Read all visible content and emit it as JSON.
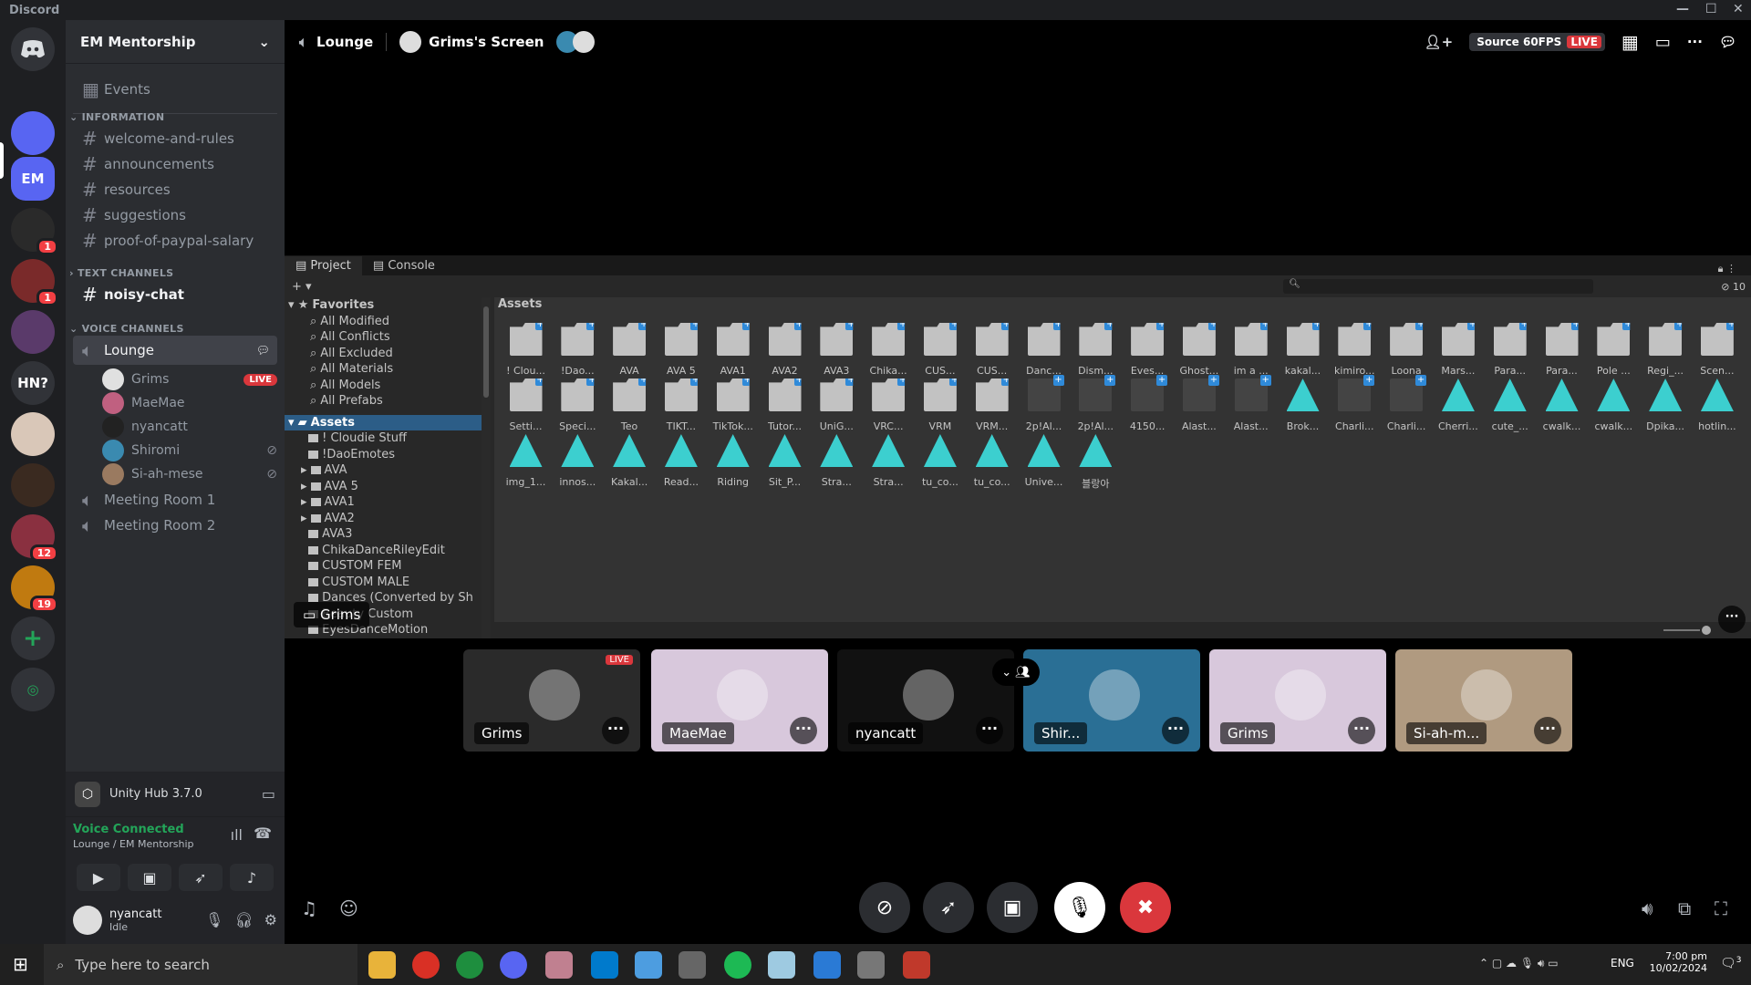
{
  "window": {
    "title": "Discord",
    "controls": [
      "—",
      "☐",
      "✕"
    ]
  },
  "guilds": [
    {
      "label": "",
      "color": "#5865f2",
      "badge": ""
    },
    {
      "label": "EM",
      "color": "#5865f2",
      "badge": ""
    },
    {
      "label": "",
      "color": "#2a2a2a",
      "badge": "1"
    },
    {
      "label": "",
      "color": "#7a2a2a",
      "badge": "1"
    },
    {
      "label": "",
      "color": "#5a3a6a",
      "badge": ""
    },
    {
      "label": "HN?",
      "color": "#313338",
      "badge": ""
    },
    {
      "label": "",
      "color": "#d9c7b8",
      "badge": ""
    },
    {
      "label": "",
      "color": "#3a2a20",
      "badge": ""
    },
    {
      "label": "",
      "color": "#8a3040",
      "badge": "12"
    },
    {
      "label": "",
      "color": "#c07a10",
      "badge": "19"
    }
  ],
  "server": {
    "name": "EM Mentorship"
  },
  "events_label": "Events",
  "categories": {
    "information": "INFORMATION",
    "text": "TEXT CHANNELS",
    "voice": "VOICE CHANNELS"
  },
  "info_channels": [
    "welcome-and-rules",
    "announcements",
    "resources",
    "suggestions",
    "proof-of-paypal-salary"
  ],
  "text_channels": [
    "noisy-chat"
  ],
  "voice_channels": {
    "lounge": "Lounge",
    "room1": "Meeting Room 1",
    "room2": "Meeting Room 2"
  },
  "voice_users": [
    {
      "name": "Grims",
      "live": "LIVE",
      "muted": false,
      "color": "#e0e0e0"
    },
    {
      "name": "MaeMae",
      "live": "",
      "muted": false,
      "color": "#c06080"
    },
    {
      "name": "nyancatt",
      "live": "",
      "muted": false,
      "color": "#222"
    },
    {
      "name": "Shiromi",
      "live": "",
      "muted": true,
      "color": "#3a8ab0"
    },
    {
      "name": "Si-ah-mese",
      "live": "",
      "muted": true,
      "color": "#9a7a60"
    }
  ],
  "activity": {
    "name": "Unity Hub 3.7.0"
  },
  "voice_status": {
    "label": "Voice Connected",
    "location": "Lounge / EM Mentorship"
  },
  "user": {
    "name": "nyancatt",
    "status": "Idle"
  },
  "topbar": {
    "channel": "Lounge",
    "screen": "Grims's Screen",
    "quality": "Source 60FPS",
    "live": "LIVE"
  },
  "unity": {
    "tabs": [
      "Project",
      "Console"
    ],
    "favorites_label": "Favorites",
    "favorites": [
      "All Modified",
      "All Conflicts",
      "All Excluded",
      "All Materials",
      "All Models",
      "All Prefabs"
    ],
    "assets_label": "Assets",
    "tree": [
      "! Cloudie Stuff",
      "!DaoEmotes",
      "AVA",
      "AVA 5",
      "AVA1",
      "AVA2",
      "AVA3",
      "ChikaDanceRileyEdit",
      "CUSTOM FEM",
      "CUSTOM MALE",
      "Dances (Converted by Sh",
      "Beauty Custom",
      "EyesDanceMotion"
    ],
    "grid_header": "Assets",
    "hidden_count": "10",
    "stream_label": "Grims",
    "row1": [
      "! Clou...",
      "!Dao...",
      "AVA",
      "AVA 5",
      "AVA1",
      "AVA2",
      "AVA3",
      "Chika...",
      "CUS...",
      "CUS...",
      "Danc...",
      "Dism...",
      "Eves...",
      "Ghost...",
      "im a ...",
      "kakal...",
      "kimiro...",
      "Loona",
      "Mars...",
      "Para...",
      "Para...",
      "Pole ...",
      "Regi_...",
      "Scen..."
    ],
    "row2": [
      "Setti...",
      "Speci...",
      "Teo",
      "TIKT...",
      "TikTok...",
      "Tutor...",
      "UniG...",
      "VRC...",
      "VRM",
      "VRM...",
      "2p!Al...",
      "2p!Al...",
      "4150...",
      "Alast...",
      "Alast...",
      "Brok...",
      "Charli...",
      "Charli...",
      "Cherri...",
      "cute_...",
      "cwalk...",
      "cwalk...",
      "Dpika...",
      "hotlin..."
    ],
    "row3": [
      "img_1...",
      "innos...",
      "Kakal...",
      "Read...",
      "Riding",
      "Sit_P...",
      "Stra...",
      "Stra...",
      "tu_co...",
      "tu_co...",
      "Unive...",
      "블랑아"
    ]
  },
  "tiles": [
    {
      "name": "Grims",
      "live": "LIVE",
      "bg": "#2a2a2a"
    },
    {
      "name": "MaeMae",
      "live": "",
      "bg": "#d8c8dc"
    },
    {
      "name": "nyancatt",
      "live": "",
      "bg": "#111"
    },
    {
      "name": "Shir...",
      "live": "",
      "bg": "#2a6f95"
    },
    {
      "name": "Grims",
      "live": "",
      "bg": "#d8c8dc"
    },
    {
      "name": "Si-ah-m...",
      "live": "",
      "bg": "#b09a80"
    }
  ],
  "taskbar": {
    "search_placeholder": "Type here to search",
    "lang": "ENG",
    "time": "7:00 pm",
    "date": "10/02/2024",
    "notifications": "3"
  },
  "colors": {
    "blurple": "#5865f2",
    "live": "#da373c",
    "green": "#23a559",
    "bg": "#2b2d31"
  }
}
